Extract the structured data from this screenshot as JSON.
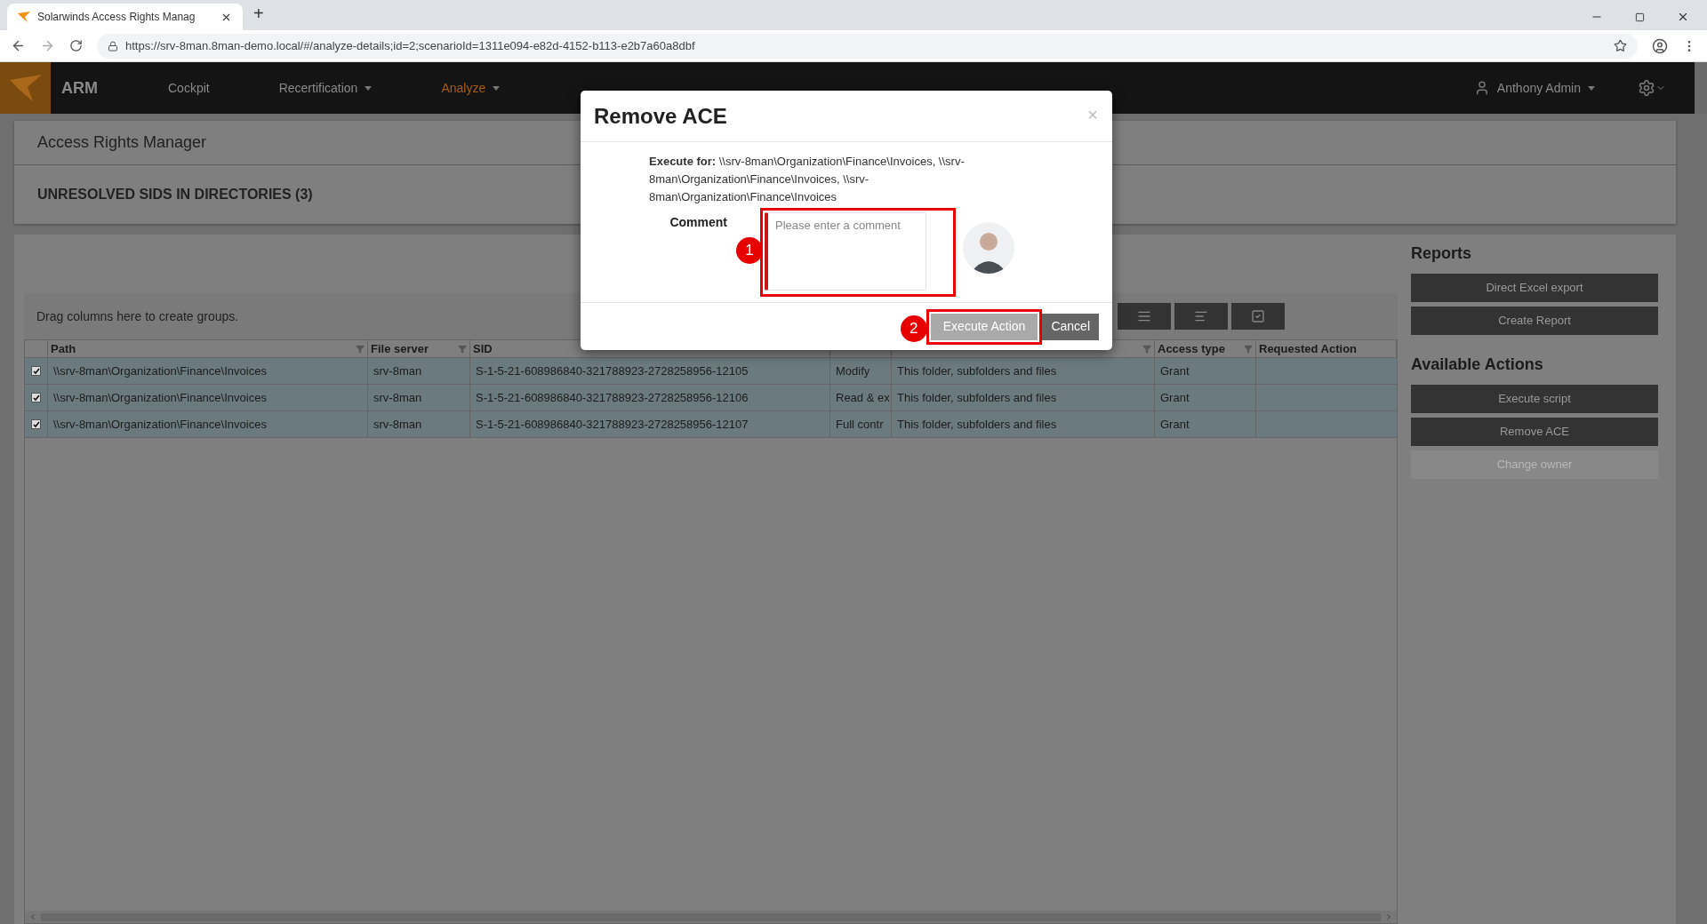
{
  "browser": {
    "tab_title": "Solarwinds Access Rights Manag",
    "new_tab": "+",
    "url": "https://srv-8man.8man-demo.local/#/analyze-details;id=2;scenarioId=1311e094-e82d-4152-b113-e2b7a60a8dbf"
  },
  "nav": {
    "brand": "ARM",
    "user": "Anthony Admin",
    "items": [
      {
        "label": "Cockpit",
        "selected": false,
        "dropdown": false
      },
      {
        "label": "Recertification",
        "selected": false,
        "dropdown": true
      },
      {
        "label": "Analyze",
        "selected": true,
        "dropdown": true
      }
    ]
  },
  "page": {
    "title": "Access Rights Manager",
    "section": "UNRESOLVED SIDS IN DIRECTORIES (3)"
  },
  "grid": {
    "group_hint": "Drag columns here to create groups.",
    "columns": [
      {
        "label": "Path",
        "filter": true
      },
      {
        "label": "File server",
        "filter": true
      },
      {
        "label": "SID",
        "filter": false
      },
      {
        "filter": false
      },
      {
        "filter": true
      },
      {
        "label": "Access type",
        "filter": true
      },
      {
        "label": "Requested Action",
        "filter": false
      }
    ],
    "rows": [
      {
        "checked": true,
        "cells": [
          "\\\\srv-8man\\Organization\\Finance\\Invoices",
          "srv-8man",
          "S-1-5-21-608986840-321788923-2728258956-12105",
          "Modify",
          "This folder, subfolders and files",
          "Grant"
        ]
      },
      {
        "checked": true,
        "cells": [
          "\\\\srv-8man\\Organization\\Finance\\Invoices",
          "srv-8man",
          "S-1-5-21-608986840-321788923-2728258956-12106",
          "Read & ex",
          "This folder, subfolders and files",
          "Grant"
        ]
      },
      {
        "checked": true,
        "cells": [
          "\\\\srv-8man\\Organization\\Finance\\Invoices",
          "srv-8man",
          "S-1-5-21-608986840-321788923-2728258956-12107",
          "Full contr",
          "This folder, subfolders and files",
          "Grant"
        ]
      }
    ]
  },
  "side": [
    {
      "title": "Reports",
      "buttons": [
        {
          "label": "Direct Excel export",
          "disabled": false
        },
        {
          "label": "Create Report",
          "disabled": false
        }
      ]
    },
    {
      "title": "Available Actions",
      "buttons": [
        {
          "label": "Execute script",
          "disabled": false
        },
        {
          "label": "Remove ACE",
          "disabled": false
        },
        {
          "label": "Change owner",
          "disabled": true
        }
      ]
    }
  ],
  "dialog": {
    "title": "Remove ACE",
    "close": "×",
    "execute_for": "**Execute for:** \\\\srv-8man\\Organization\\Finance\\Invoices, \\\\srv-8man\\Organization\\Finance\\Invoices, \\\\srv-8man\\Organization\\Finance\\Invoices",
    "comment_label": "Comment",
    "comment_placeholder": "Please enter a comment",
    "buttons": [
      {
        "label": "Execute Action",
        "kind": "primary",
        "callout": "2"
      },
      {
        "label": "Cancel",
        "kind": "secondary"
      }
    ],
    "comment_callout": "1"
  }
}
